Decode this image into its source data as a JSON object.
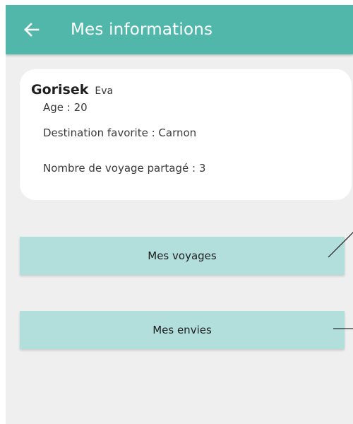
{
  "header": {
    "title": "Mes informations",
    "back_icon": "arrow-left-icon",
    "background": "#52b7ab"
  },
  "profile": {
    "last_name": "Gorisek",
    "first_name": "Eva",
    "age": "Age : 20",
    "favorite_destination": "Destination favorite : Carnon",
    "shared_trips": "Nombre de voyage partagé : 3"
  },
  "actions": {
    "trips_label": "Mes voyages",
    "wishes_label": "Mes envies",
    "button_color": "#b2dfdb"
  }
}
